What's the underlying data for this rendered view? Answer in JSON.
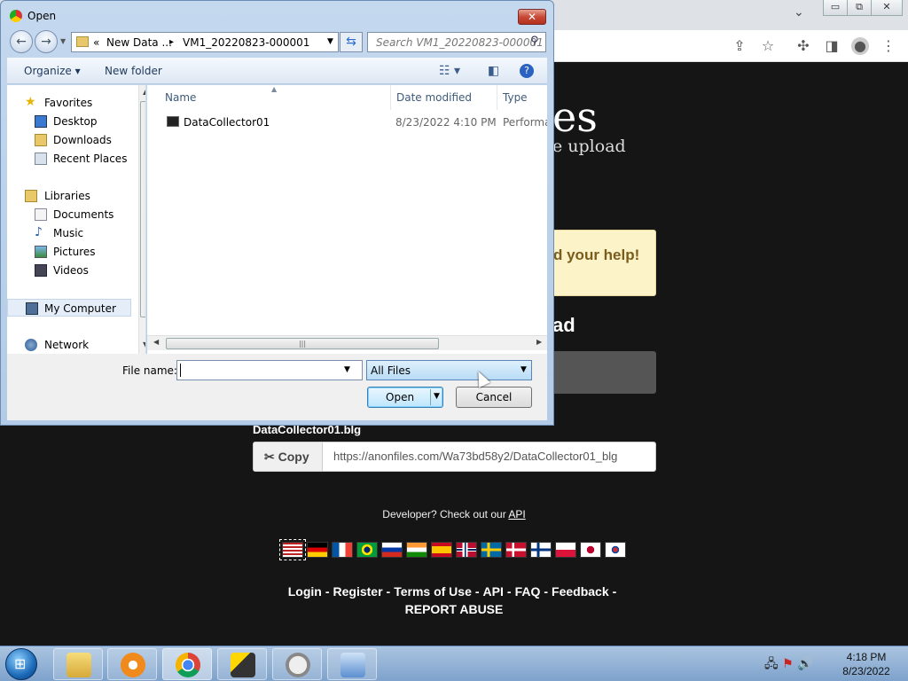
{
  "browser": {
    "caption_buttons": [
      "▭",
      "⧉",
      "✕"
    ],
    "tab_dropdown": "⌄",
    "toolbar_icons": [
      "share-icon",
      "star-icon",
      "puzzle-icon",
      "sidepanel-icon",
      "profile-icon",
      "menu-icon"
    ]
  },
  "page": {
    "logo_fragment": "es",
    "tagline_fragment": "e upload",
    "help_fragment": "d your help!",
    "upload_fragment": "ad",
    "uploaded_file": "DataCollector01.blg",
    "copy_label": "Copy",
    "share_url": "https://anonfiles.com/Wa73bd58y2/DataCollector01_blg",
    "dev_text": "Developer? Check out our ",
    "dev_link": "API",
    "footer": {
      "login": "Login",
      "register": "Register",
      "terms": "Terms of Use",
      "api": "API",
      "faq": "FAQ",
      "feedback": "Feedback",
      "report": "REPORT ABUSE"
    },
    "flags": [
      "us",
      "de",
      "fr",
      "br",
      "ru",
      "in",
      "es",
      "no",
      "se",
      "dk",
      "fi",
      "pl",
      "jp",
      "kr"
    ]
  },
  "dialog": {
    "title": "Open",
    "close": "✕",
    "address": {
      "overflow": "«",
      "crumb1": "New Data ...",
      "sep": "▸",
      "crumb2": "VM1_20220823-000001"
    },
    "search_placeholder": "Search VM1_20220823-000001",
    "toolbar": {
      "organize": "Organize ▾",
      "new_folder": "New folder"
    },
    "nav": {
      "favorites": "Favorites",
      "desktop": "Desktop",
      "downloads": "Downloads",
      "recent": "Recent Places",
      "libraries": "Libraries",
      "documents": "Documents",
      "music": "Music",
      "pictures": "Pictures",
      "videos": "Videos",
      "computer": "My Computer",
      "network": "Network"
    },
    "columns": {
      "name": "Name",
      "date": "Date modified",
      "type": "Type"
    },
    "files": [
      {
        "name": "DataCollector01",
        "date": "8/23/2022 4:10 PM",
        "type": "Performa"
      }
    ],
    "file_name_label": "File name:",
    "file_name_value": "",
    "file_type": "All Files",
    "open_label": "Open",
    "cancel_label": "Cancel"
  },
  "taskbar": {
    "time": "4:18 PM",
    "date": "8/23/2022"
  }
}
